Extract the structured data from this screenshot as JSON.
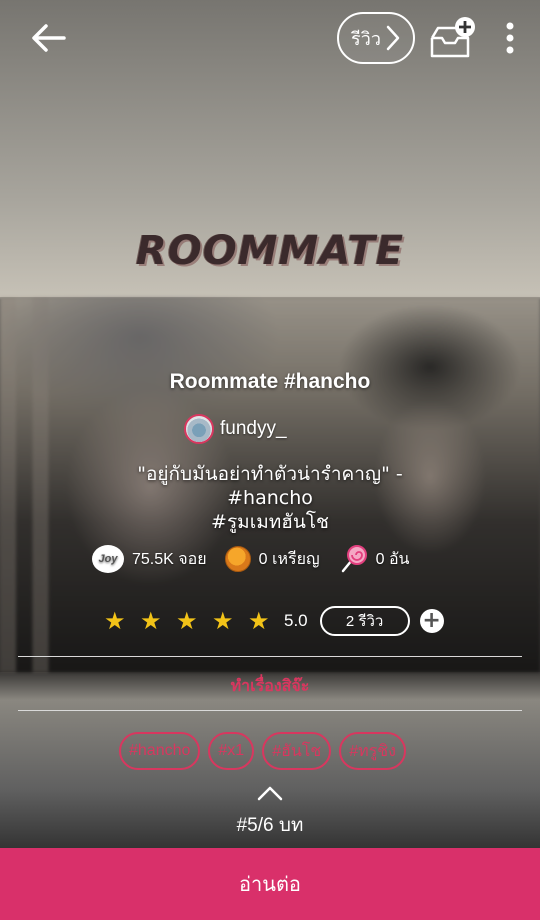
{
  "header": {
    "review_label": "รีวิว",
    "icons": {
      "back": "arrow-left-icon",
      "review_chevron": "chevron-right-icon",
      "library": "add-to-library-icon",
      "more": "more-vertical-icon"
    }
  },
  "cover": {
    "logo_text": "ROOMMATE"
  },
  "story": {
    "title": "Roommate #hancho",
    "author": "fundyy_",
    "description_lines": [
      "\"อยู่กับมันอย่าทำตัวน่ารำคาญ\" -",
      "#hancho",
      "#รูมเมทฮันโช"
    ]
  },
  "stats": {
    "joy_icon_text": "Joy",
    "joy": "75.5K จอย",
    "coins": "0 เหรียญ",
    "lollipops": "0 อัน"
  },
  "rating": {
    "stars": 5,
    "value": "5.0",
    "reviews": "2 รีวิว",
    "add_symbol": "+"
  },
  "genre": "ทำเรื่องสิจ๊ะ",
  "tags": [
    "#hancho",
    "#x1",
    "#ฮันโช",
    "#ทรูชิง"
  ],
  "episode": "#5/6 บท",
  "read_button": "อ่านต่อ",
  "colors": {
    "accent": "#d8375f",
    "read_button": "#d9306a",
    "star": "#f2c318"
  }
}
